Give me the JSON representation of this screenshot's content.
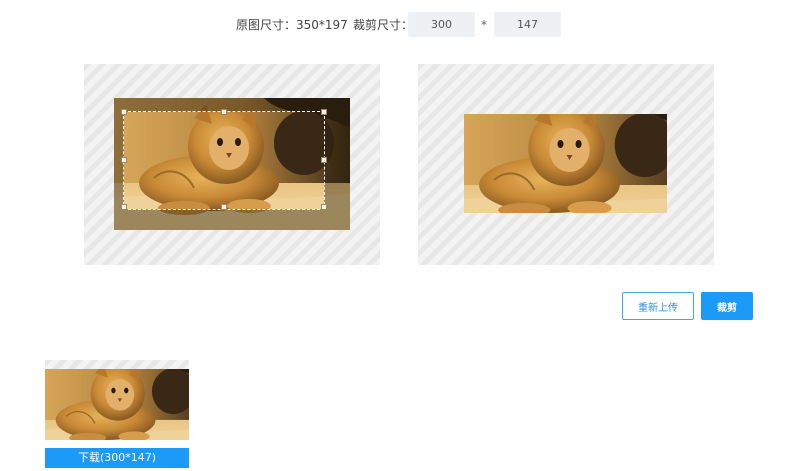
{
  "header": {
    "original_size_label": "原图尺寸：350*197",
    "crop_size_label": "裁剪尺寸：",
    "crop_width": "300",
    "separator": "*",
    "crop_height": "147"
  },
  "actions": {
    "reupload_label": "重新上传",
    "crop_label": "裁剪"
  },
  "result": {
    "download_label": "下载(300*147)"
  },
  "colors": {
    "accent": "#1b9af7",
    "input_bg": "#eef1f4"
  }
}
